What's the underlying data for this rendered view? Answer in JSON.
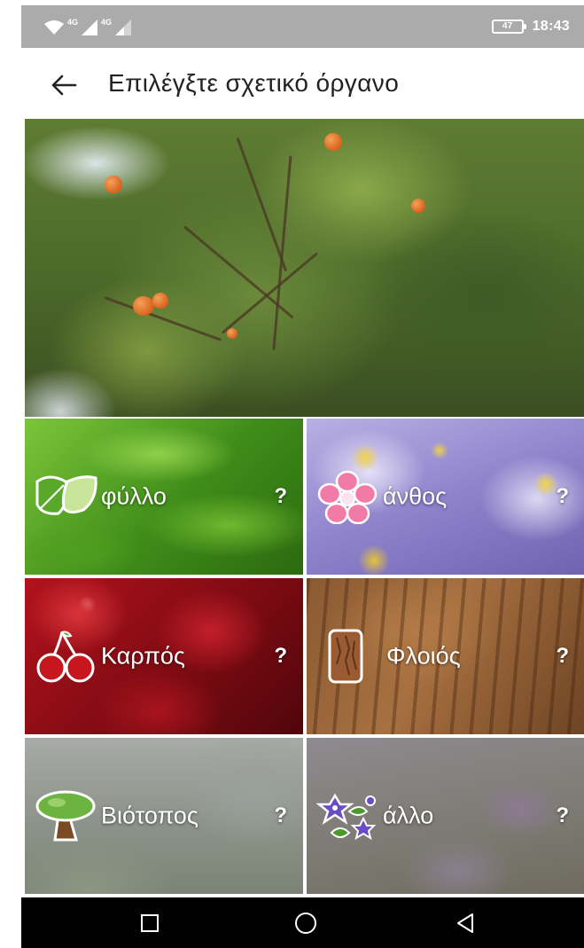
{
  "status_bar": {
    "network_1": "4G",
    "network_2": "4G",
    "battery": "47",
    "time": "18:43"
  },
  "app_bar": {
    "title": "Επιλέγξτε σχετικό όργανο"
  },
  "organs": [
    {
      "label": "φύλλο",
      "help": "?",
      "icon": "leaf-icon"
    },
    {
      "label": "άνθος",
      "help": "?",
      "icon": "flower-icon"
    },
    {
      "label": "Καρπός",
      "help": "?",
      "icon": "cherry-icon"
    },
    {
      "label": "Φλοιός",
      "help": "?",
      "icon": "bark-icon"
    },
    {
      "label": "Βιότοπος",
      "help": "?",
      "icon": "tree-icon"
    },
    {
      "label": "άλλο",
      "help": "?",
      "icon": "other-flowers-icon"
    }
  ],
  "colors": {
    "status_bar": "#ababab",
    "title_text": "#222222",
    "nav_bar": "#000000"
  }
}
